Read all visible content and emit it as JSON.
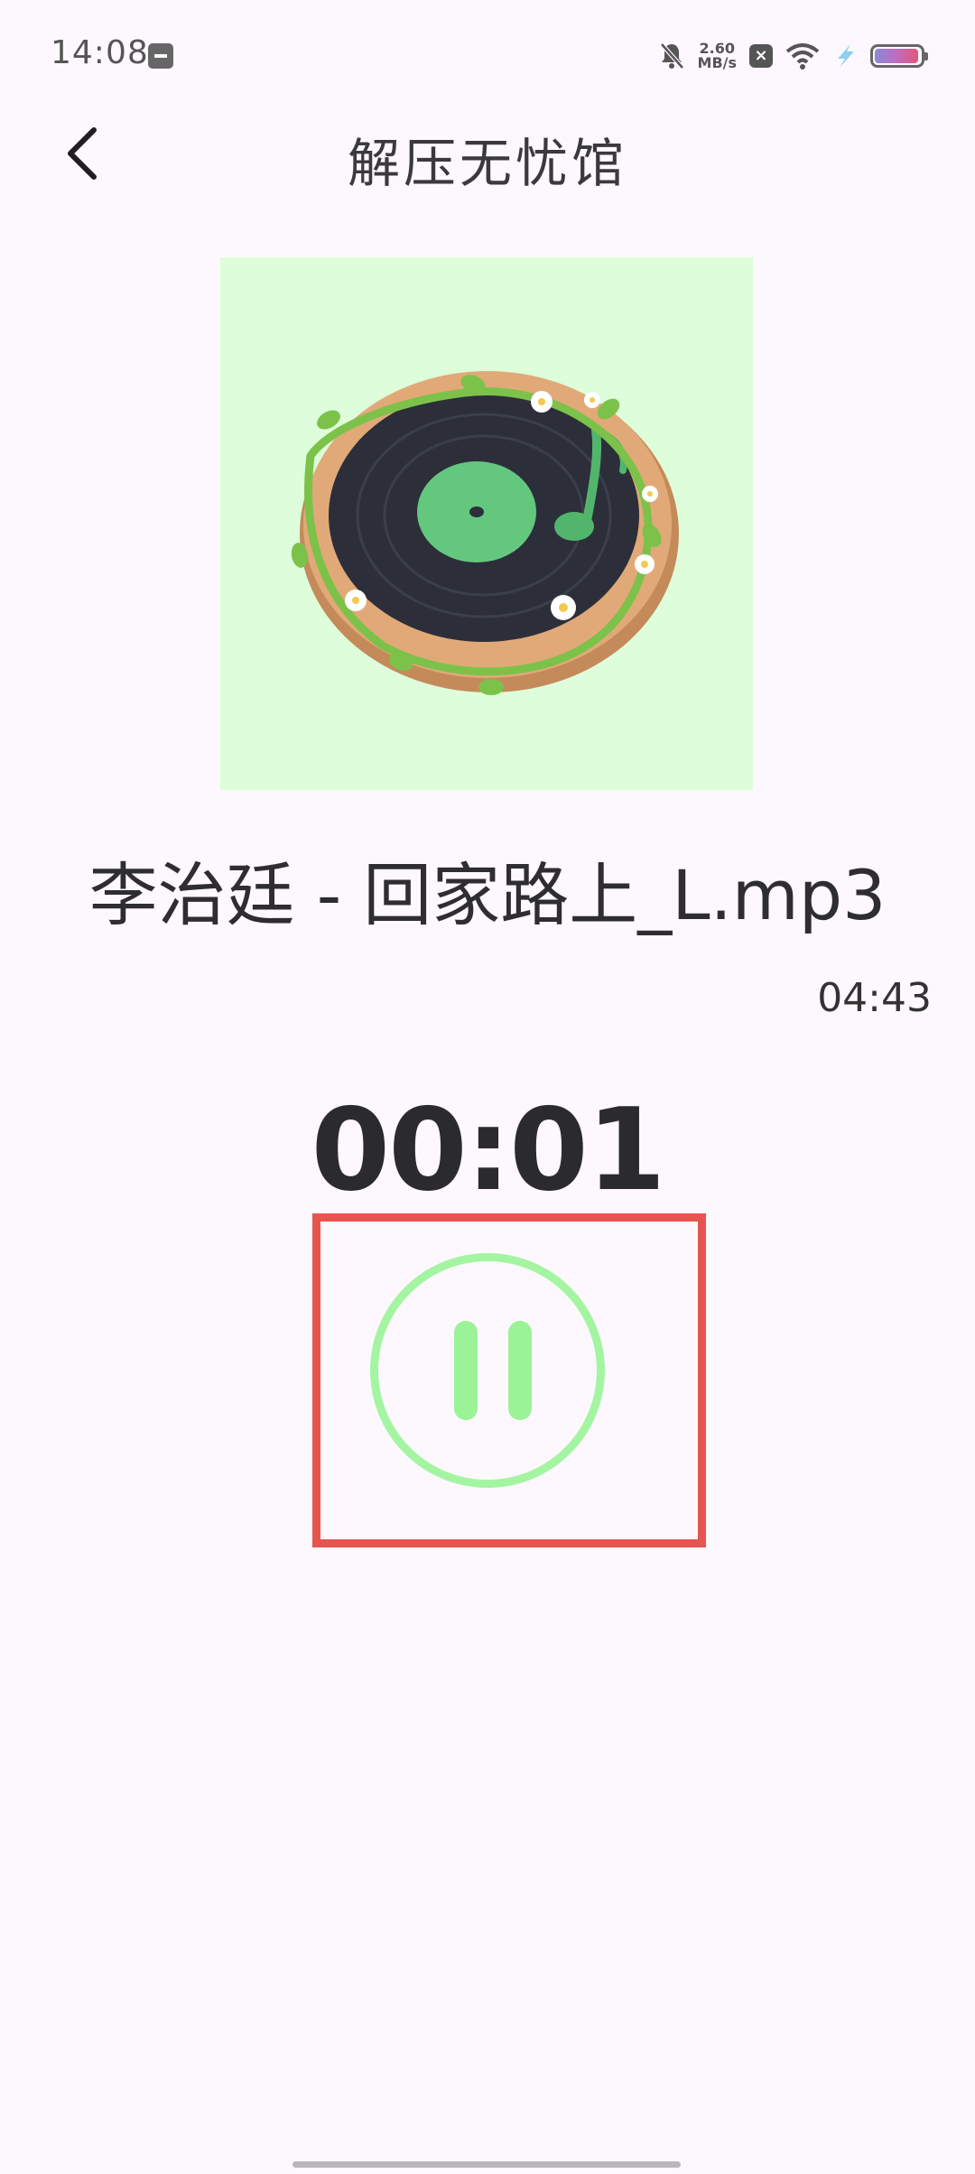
{
  "status_bar": {
    "time": "14:08",
    "net_speed_value": "2.60",
    "net_speed_unit": "MB/s",
    "icons": [
      "app-notification-icon",
      "bell-muted-icon",
      "close-box-icon",
      "wifi-icon",
      "bolt-icon",
      "battery-icon"
    ],
    "battery_colors": [
      "#8a8ad6",
      "#c06cc0",
      "#e0567a"
    ]
  },
  "header": {
    "title": "解压无忧馆",
    "back_icon": "chevron-left-icon"
  },
  "cover": {
    "background": "#ddfddb",
    "description_icon": "vinyl-record-image"
  },
  "player": {
    "song_title": "李治廷 - 回家路上_L.mp3",
    "total_time": "04:43",
    "current_time": "00:01",
    "control_icon": "pause-icon",
    "control_color": "#a4f5a2",
    "highlight_color": "#e8544f"
  }
}
